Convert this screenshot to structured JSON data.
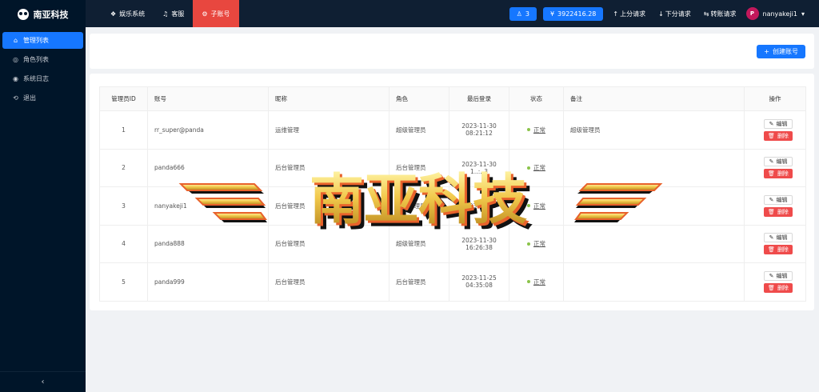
{
  "app": {
    "logo_text": "南亚科技"
  },
  "sidebar": {
    "items": [
      {
        "label": "管理列表",
        "icon": "home-icon",
        "active": true
      },
      {
        "label": "角色列表",
        "icon": "circle-icon",
        "active": false
      },
      {
        "label": "系统日志",
        "icon": "target-icon",
        "active": false
      },
      {
        "label": "退出",
        "icon": "logout-icon",
        "active": false
      }
    ],
    "collapse_icon": "chevron-left-icon"
  },
  "header": {
    "nav": [
      {
        "label": "娱乐系统",
        "icon": "dropbox-icon",
        "active": false
      },
      {
        "label": "客服",
        "icon": "headset-icon",
        "active": false
      },
      {
        "label": "子账号",
        "icon": "gear-icon",
        "active": true
      }
    ],
    "user_count": "3",
    "balance": "3922416.28",
    "up_request": "上分请求",
    "down_request": "下分请求",
    "transfer_request": "转账请求",
    "avatar_letter": "P",
    "username": "nanyakeji1"
  },
  "toolbar": {
    "create_label": "创建账号"
  },
  "table": {
    "headers": [
      "管理员ID",
      "账号",
      "昵称",
      "角色",
      "最后登录",
      "状态",
      "备注",
      "操作"
    ],
    "edit_label": "编辑",
    "delete_label": "删除",
    "rows": [
      {
        "id": "1",
        "account": "rr_super@panda",
        "nickname": "运维管理",
        "role": "超级管理员",
        "login_date": "2023-11-30",
        "login_time": "08:21:12",
        "status": "正常",
        "note": "超级管理员"
      },
      {
        "id": "2",
        "account": "panda666",
        "nickname": "后台管理员",
        "role": "后台管理员",
        "login_date": "2023-11-30",
        "login_time": "1‥:‥3",
        "status": "正常",
        "note": ""
      },
      {
        "id": "3",
        "account": "nanyakeji1",
        "nickname": "后台管理员",
        "role": "后台管理员",
        "login_date": "2023-11-30",
        "login_time": "",
        "status": "正常",
        "note": ""
      },
      {
        "id": "4",
        "account": "panda888",
        "nickname": "后台管理员",
        "role": "超级管理员",
        "login_date": "2023-11-30",
        "login_time": "16:26:38",
        "status": "正常",
        "note": ""
      },
      {
        "id": "5",
        "account": "panda999",
        "nickname": "后台管理员",
        "role": "后台管理员",
        "login_date": "2023-11-25",
        "login_time": "04:35:08",
        "status": "正常",
        "note": ""
      }
    ]
  },
  "watermark": {
    "text": "南亚科技"
  },
  "colors": {
    "sidebar": "#001529",
    "header": "#0f1f33",
    "accent": "#1677ff",
    "active_nav": "#e8473f",
    "danger": "#ef4b4b"
  }
}
